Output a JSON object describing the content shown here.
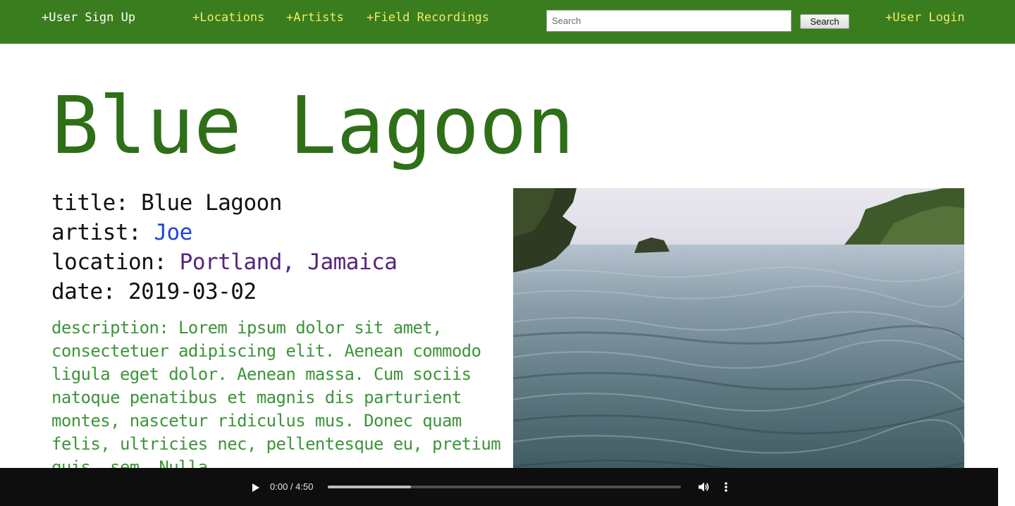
{
  "nav": {
    "signup": "+User Sign Up",
    "locations": "+Locations",
    "artists": "+Artists",
    "recordings": "+Field Recordings",
    "login": "+User Login"
  },
  "search": {
    "placeholder": "Search",
    "button_label": "Search"
  },
  "page": {
    "title": "Blue Lagoon"
  },
  "details": {
    "title_label": "title:",
    "title_value": "Blue Lagoon",
    "artist_label": "artist:",
    "artist_value": "Joe",
    "location_label": "location:",
    "location_value": "Portland, Jamaica",
    "date_label": "date:",
    "date_value": "2019-03-02"
  },
  "description": "description: Lorem ipsum dolor sit amet, consectetuer adipiscing elit. Aenean commodo ligula eget dolor. Aenean massa. Cum sociis natoque penatibus et magnis dis parturient montes, nascetur ridiculus mus. Donec quam felis, ultricies nec, pellentesque eu, pretium quis, sem. Nulla",
  "audio": {
    "time": "0:00 / 4:50",
    "progress_fraction": 0.235
  },
  "colors": {
    "nav_bg": "#3a7d1e",
    "title": "#2e6f18",
    "description": "#3e943a",
    "artist_link": "#2144d6",
    "location_link": "#55237f"
  },
  "icons": {
    "play": "play-icon",
    "volume": "volume-icon",
    "more": "more-vertical-icon"
  }
}
